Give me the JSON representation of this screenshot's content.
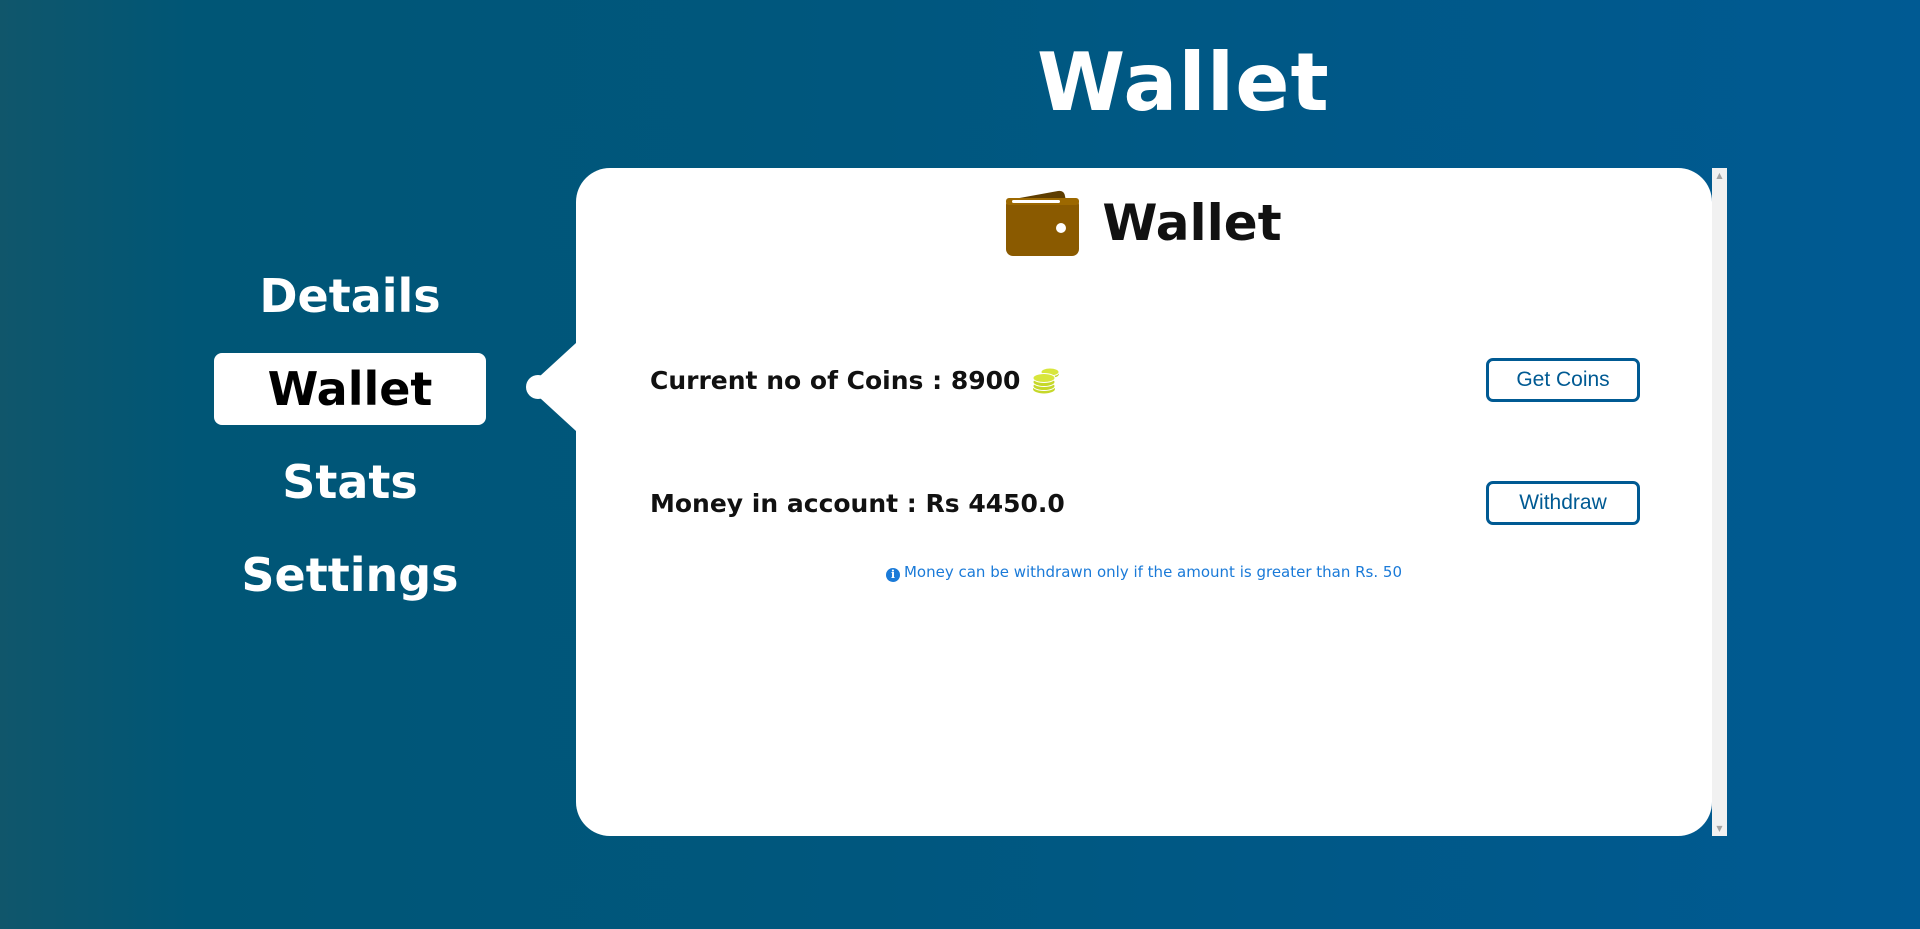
{
  "header": {
    "title": "Wallet"
  },
  "sidebar": {
    "items": [
      {
        "label": "Details",
        "active": false
      },
      {
        "label": "Wallet",
        "active": true
      },
      {
        "label": "Stats",
        "active": false
      },
      {
        "label": "Settings",
        "active": false
      }
    ]
  },
  "panel": {
    "title": "Wallet",
    "icon": "wallet-icon",
    "coins": {
      "label": "Current no of Coins : 8900",
      "icon": "coins-icon",
      "button_label": "Get Coins"
    },
    "money": {
      "label": "Money in account : Rs 4450.0",
      "button_label": "Withdraw"
    },
    "info_note": "Money can be withdrawn only if the amount is greater than Rs. 50",
    "info_icon": "info-icon"
  },
  "colors": {
    "accent": "#005a93",
    "wallet_brown": "#8a5a00",
    "coins_yellow": "#c6d82a",
    "info_blue": "#1a7ad8"
  }
}
